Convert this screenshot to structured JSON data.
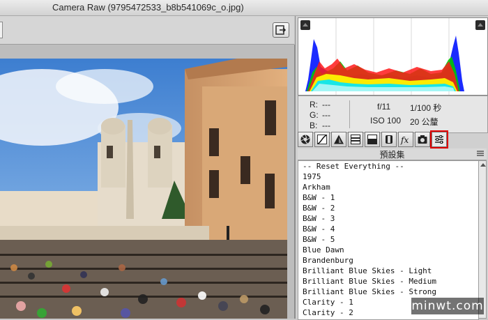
{
  "window": {
    "title": "Camera Raw (9795472533_b8b541069c_o.jpg)"
  },
  "readout": {
    "r_label": "R:",
    "r_value": "---",
    "g_label": "G:",
    "g_value": "---",
    "b_label": "B:",
    "b_value": "---",
    "aperture": "f/11",
    "shutter": "1/100 秒",
    "iso": "ISO 100",
    "focal": "20 公釐"
  },
  "tabs": [
    {
      "name": "basic-tab-icon"
    },
    {
      "name": "tone-curve-tab-icon"
    },
    {
      "name": "detail-tab-icon"
    },
    {
      "name": "hsl-tab-icon"
    },
    {
      "name": "split-toning-tab-icon"
    },
    {
      "name": "lens-corrections-tab-icon"
    },
    {
      "name": "effects-tab-icon"
    },
    {
      "name": "camera-calibration-tab-icon"
    },
    {
      "name": "presets-tab-icon",
      "selected": true
    }
  ],
  "presets": {
    "header": "預設集",
    "items": [
      "-- Reset Everything --",
      "1975",
      "Arkham",
      "B&W - 1",
      "B&W - 2",
      "B&W - 3",
      "B&W - 4",
      "B&W - 5",
      "Blue Dawn",
      "Brandenburg",
      "Brilliant Blue Skies - Light",
      "Brilliant Blue Skies - Medium",
      "Brilliant Blue Skies - Strong",
      "Clarity - 1",
      "Clarity - 2"
    ]
  },
  "watermark": "minwt.com",
  "colors": {
    "selected_outline": "#e00000",
    "panel_bg": "#d0d0d0"
  }
}
